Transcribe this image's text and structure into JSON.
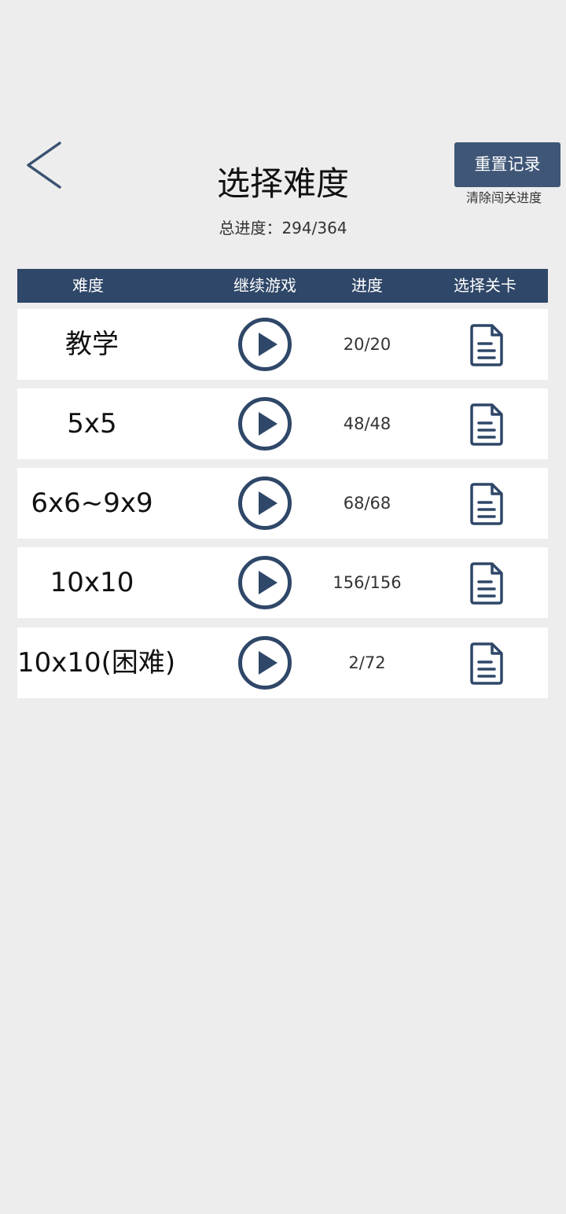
{
  "header": {
    "back_icon": "chevron-left-icon",
    "title": "选择难度",
    "total_progress_label": "总进度：294/364",
    "reset_button_label": "重置记录",
    "reset_note": "清除闯关进度"
  },
  "table": {
    "headers": [
      "难度",
      "继续游戏",
      "进度",
      "选择关卡"
    ],
    "rows": [
      {
        "name": "教学",
        "progress": "20/20",
        "play_icon": "play-circle-icon",
        "levels_icon": "document-icon"
      },
      {
        "name": "5x5",
        "progress": "48/48",
        "play_icon": "play-circle-icon",
        "levels_icon": "document-icon"
      },
      {
        "name": "6x6~9x9",
        "progress": "68/68",
        "play_icon": "play-circle-icon",
        "levels_icon": "document-icon"
      },
      {
        "name": "10x10",
        "progress": "156/156",
        "play_icon": "play-circle-icon",
        "levels_icon": "document-icon"
      },
      {
        "name": "10x10(困难)",
        "progress": "2/72",
        "play_icon": "play-circle-icon",
        "levels_icon": "document-icon"
      }
    ]
  },
  "colors": {
    "background": "#ededed",
    "header_bar": "#2f4768",
    "accent": "#2f4768",
    "reset_button": "#3f5677",
    "row_background": "#ffffff"
  }
}
